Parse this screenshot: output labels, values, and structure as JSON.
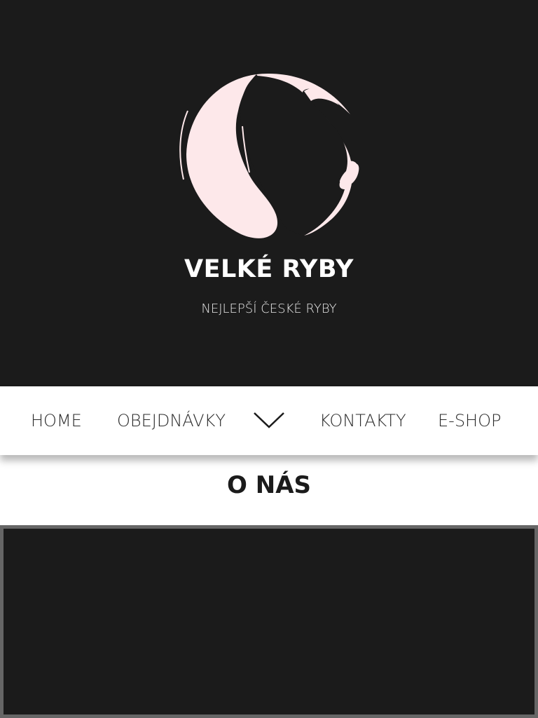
{
  "brand": {
    "title": "VELKÉ RYBY",
    "tagline": "NEJLEPŠÍ ČESKÉ RYBY",
    "logo_icon": "fish-circle-logo",
    "accent_color": "#fde8ea",
    "background_color": "#1b1b1b"
  },
  "nav": {
    "items": [
      {
        "label": "HOME"
      },
      {
        "label": "OBEJDNÁVKY"
      },
      {
        "label": "KONTAKTY"
      },
      {
        "label": "E-SHOP"
      }
    ],
    "toggle_icon": "chevron-down-icon"
  },
  "main": {
    "section_title": "O NÁS"
  }
}
